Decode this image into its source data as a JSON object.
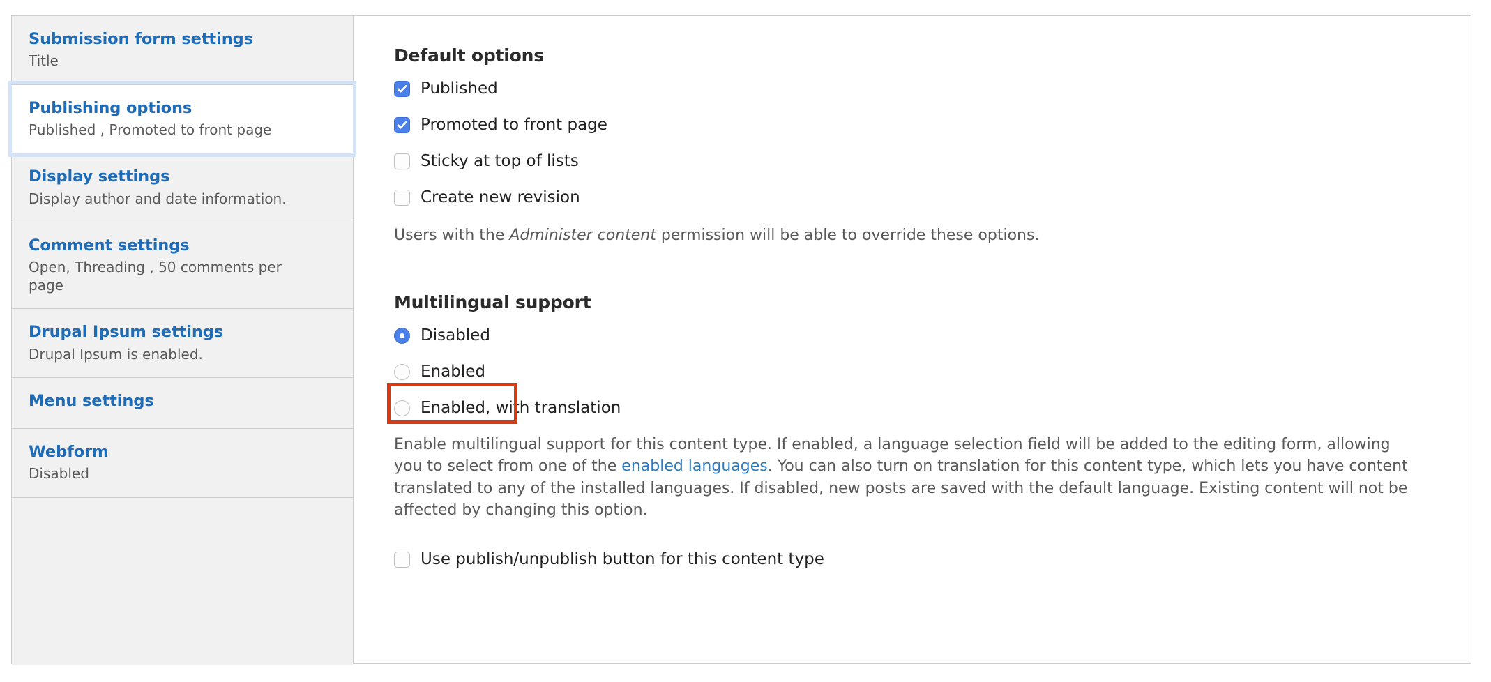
{
  "sidebar": {
    "items": [
      {
        "title": "Submission form settings",
        "summary": "Title",
        "selected": false
      },
      {
        "title": "Publishing options",
        "summary": "Published , Promoted to front page",
        "selected": true
      },
      {
        "title": "Display settings",
        "summary": "Display author and date information.",
        "selected": false
      },
      {
        "title": "Comment settings",
        "summary": "Open, Threading , 50 comments per page",
        "selected": false
      },
      {
        "title": "Drupal Ipsum settings",
        "summary": "Drupal Ipsum is enabled.",
        "selected": false
      },
      {
        "title": "Menu settings",
        "summary": "",
        "selected": false
      },
      {
        "title": "Webform",
        "summary": "Disabled",
        "selected": false
      }
    ]
  },
  "main": {
    "default_options": {
      "heading": "Default options",
      "checkboxes": [
        {
          "label": "Published",
          "checked": true
        },
        {
          "label": "Promoted to front page",
          "checked": true
        },
        {
          "label": "Sticky at top of lists",
          "checked": false
        },
        {
          "label": "Create new revision",
          "checked": false
        }
      ],
      "description_before": "Users with the ",
      "description_emphasis": "Administer content",
      "description_after": " permission will be able to override these options."
    },
    "multilingual_support": {
      "heading": "Multilingual support",
      "radios": [
        {
          "label": "Disabled",
          "selected": true
        },
        {
          "label": "Enabled",
          "selected": false
        },
        {
          "label": "Enabled, with translation",
          "selected": false
        }
      ],
      "description_part1": "Enable multilingual support for this content type. If enabled, a language selection field will be added to the editing form, allowing you to select from one of the ",
      "description_link": "enabled languages",
      "description_part2": ". You can also turn on translation for this content type, which lets you have content translated to any of the installed languages. If disabled, new posts are saved with the default language. Existing content will not be affected by changing this option."
    },
    "publish_button_option": {
      "label": "Use publish/unpublish button for this content type",
      "checked": false
    }
  },
  "annotation": {
    "target_label": "Enabled",
    "color": "#d63b17"
  }
}
